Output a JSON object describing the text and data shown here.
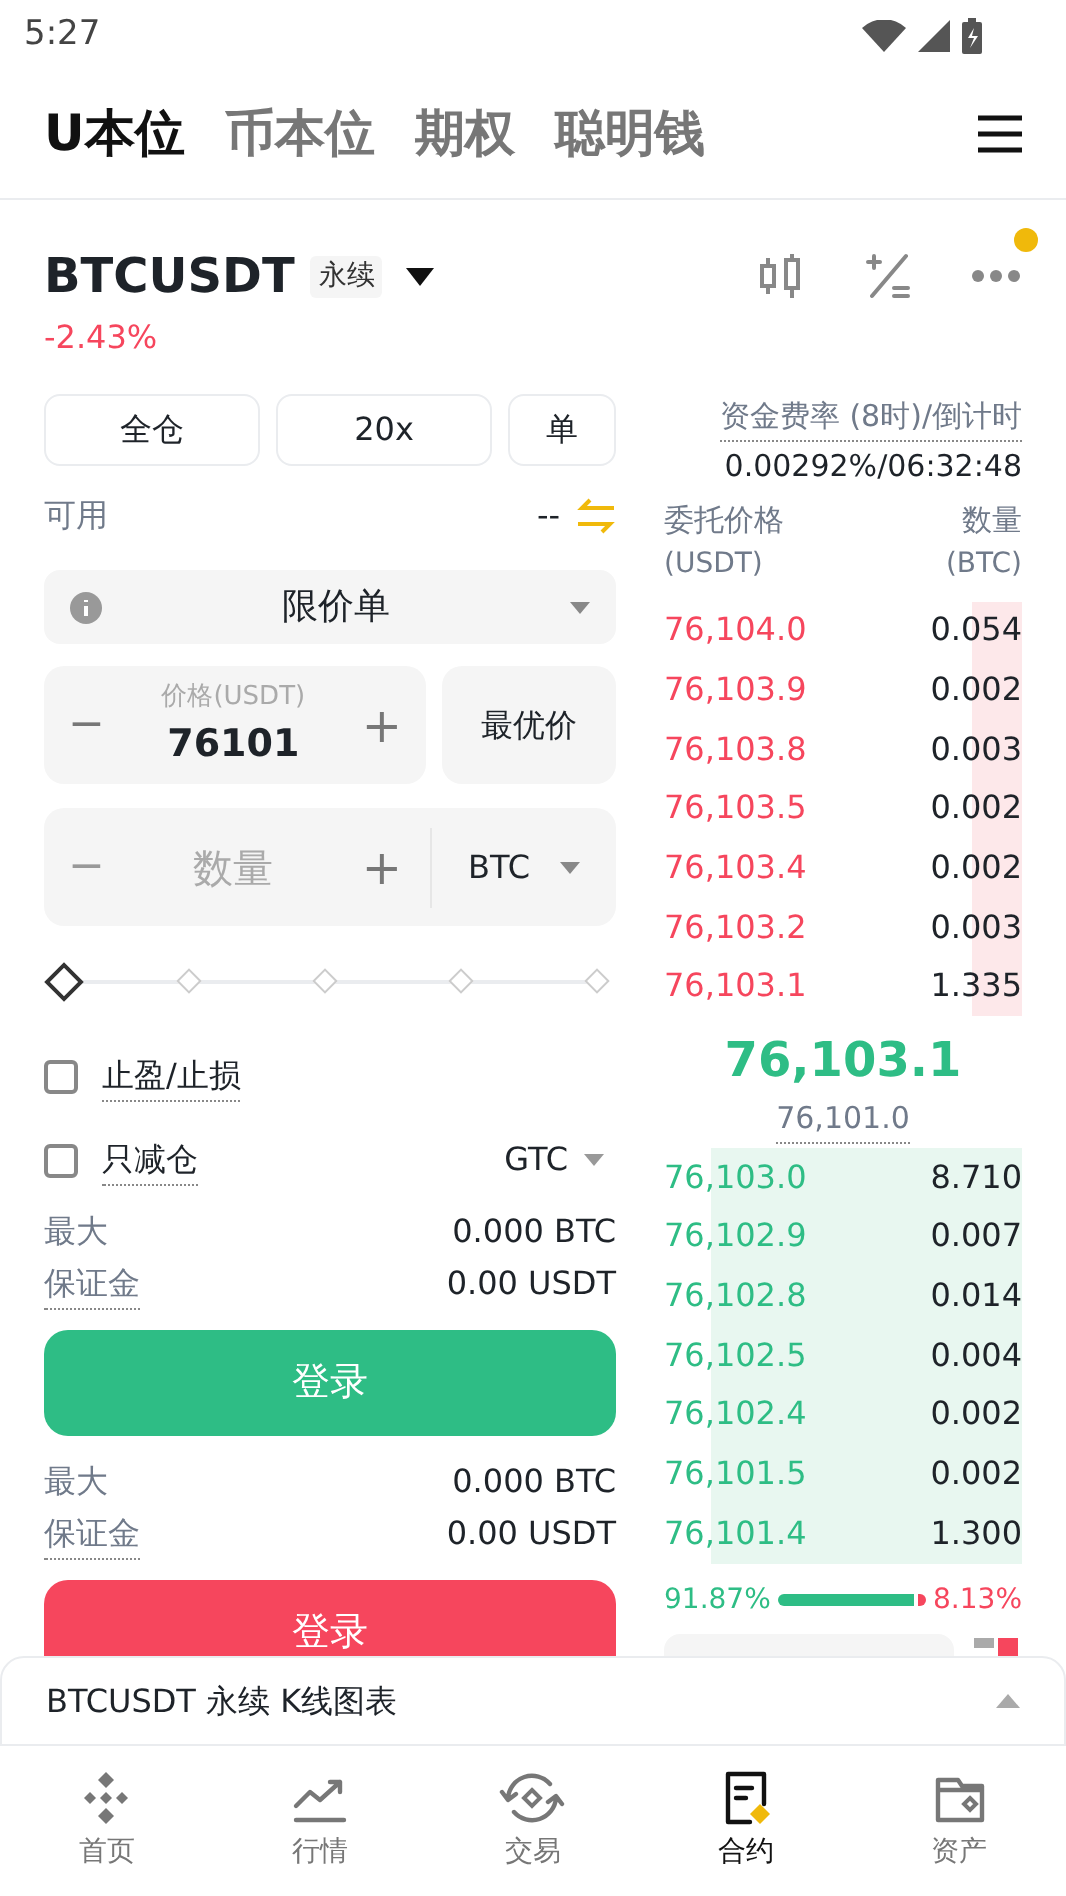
{
  "status_bar": {
    "time": "5:27"
  },
  "top_tabs": [
    {
      "label": "U本位",
      "selected": true
    },
    {
      "label": "币本位",
      "selected": false
    },
    {
      "label": "期权",
      "selected": false
    },
    {
      "label": "聪明钱",
      "selected": false
    }
  ],
  "ticker": {
    "symbol": "BTCUSDT",
    "badge": "永续",
    "change": "-2.43%",
    "notification": true
  },
  "order_form": {
    "margin_mode": "全仓",
    "leverage": "20x",
    "position_mode": "单",
    "available_label": "可用",
    "available_value": "--",
    "order_type": "限价单",
    "price": {
      "label": "价格(USDT)",
      "value": "76101",
      "minus": "−",
      "plus": "+"
    },
    "best_price": "最优价",
    "quantity": {
      "placeholder": "数量",
      "unit": "BTC",
      "minus": "−",
      "plus": "+"
    },
    "slider": {
      "level": 0
    },
    "options": [
      {
        "label": "止盈/止损",
        "checked": false
      },
      {
        "label": "只减仓",
        "checked": false
      }
    ],
    "time_in_force": "GTC",
    "sides": [
      {
        "kind": "buy",
        "rows": [
          {
            "label": "最大",
            "value": "0.000 BTC"
          },
          {
            "label": "保证金",
            "value": "0.00 USDT"
          }
        ],
        "button": "登录"
      },
      {
        "kind": "sell",
        "rows": [
          {
            "label": "最大",
            "value": "0.000 BTC"
          },
          {
            "label": "保证金",
            "value": "0.00 USDT"
          }
        ],
        "button": "登录"
      }
    ]
  },
  "order_book": {
    "funding_label": "资金费率 (8时)/倒计时",
    "funding_value": "0.00292%/06:32:48",
    "price_header": "委托价格",
    "price_unit": "(USDT)",
    "qty_header": "数量",
    "qty_unit": "(BTC)",
    "asks": [
      {
        "price": "76,104.0",
        "qty": "0.054"
      },
      {
        "price": "76,103.9",
        "qty": "0.002"
      },
      {
        "price": "76,103.8",
        "qty": "0.003"
      },
      {
        "price": "76,103.5",
        "qty": "0.002"
      },
      {
        "price": "76,103.4",
        "qty": "0.002"
      },
      {
        "price": "76,103.2",
        "qty": "0.003"
      },
      {
        "price": "76,103.1",
        "qty": "1.335"
      }
    ],
    "last_price": "76,103.1",
    "mark_price": "76,101.0",
    "bids": [
      {
        "price": "76,103.0",
        "qty": "8.710"
      },
      {
        "price": "76,102.9",
        "qty": "0.007"
      },
      {
        "price": "76,102.8",
        "qty": "0.014"
      },
      {
        "price": "76,102.5",
        "qty": "0.004"
      },
      {
        "price": "76,102.4",
        "qty": "0.002"
      },
      {
        "price": "76,101.5",
        "qty": "0.002"
      },
      {
        "price": "76,101.4",
        "qty": "1.300"
      }
    ],
    "buy_ratio": {
      "text": "91.87%",
      "level": 0.9187
    },
    "sell_ratio": "8.13%"
  },
  "bottom_sheet": {
    "title": "BTCUSDT 永续 K线图表"
  },
  "nav": [
    {
      "label": "首页",
      "kind": "home",
      "selected": false
    },
    {
      "label": "行情",
      "kind": "markets",
      "selected": false
    },
    {
      "label": "交易",
      "kind": "trade",
      "selected": false
    },
    {
      "label": "合约",
      "kind": "futures",
      "selected": true
    },
    {
      "label": "资产",
      "kind": "wallet",
      "selected": false
    }
  ]
}
